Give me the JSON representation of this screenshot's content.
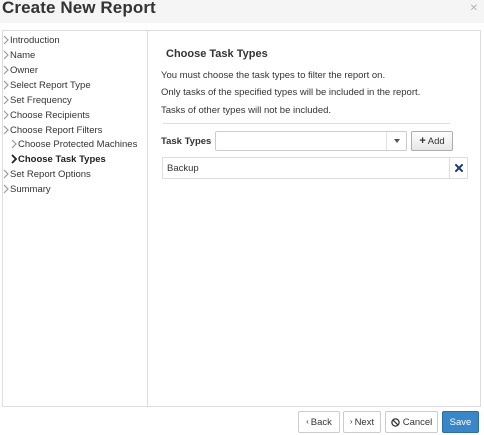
{
  "dialog": {
    "title": "Create New Report"
  },
  "sidebar": {
    "items": [
      {
        "label": "Introduction"
      },
      {
        "label": "Name"
      },
      {
        "label": "Owner"
      },
      {
        "label": "Select Report Type"
      },
      {
        "label": "Set Frequency"
      },
      {
        "label": "Choose Recipients"
      },
      {
        "label": "Choose Report Filters"
      },
      {
        "label": "Choose Protected Machines"
      },
      {
        "label": "Choose Task Types"
      },
      {
        "label": "Set Report Options"
      },
      {
        "label": "Summary"
      }
    ]
  },
  "main": {
    "section_title": "Choose Task Types",
    "descriptions": [
      "You must choose the task types to filter the report on.",
      "Only tasks of the specified types will be included in the report.",
      "Tasks of other types will not be included."
    ],
    "task_types_label": "Task Types",
    "task_types_value": "",
    "add_label": "Add",
    "selected_items": [
      "Backup"
    ]
  },
  "footer": {
    "back_label": "Back",
    "next_label": "Next",
    "cancel_label": "Cancel",
    "save_label": "Save"
  },
  "colors": {
    "primary": "#3a87c8",
    "border": "#dddddd",
    "remove_icon": "#1f3f73"
  }
}
